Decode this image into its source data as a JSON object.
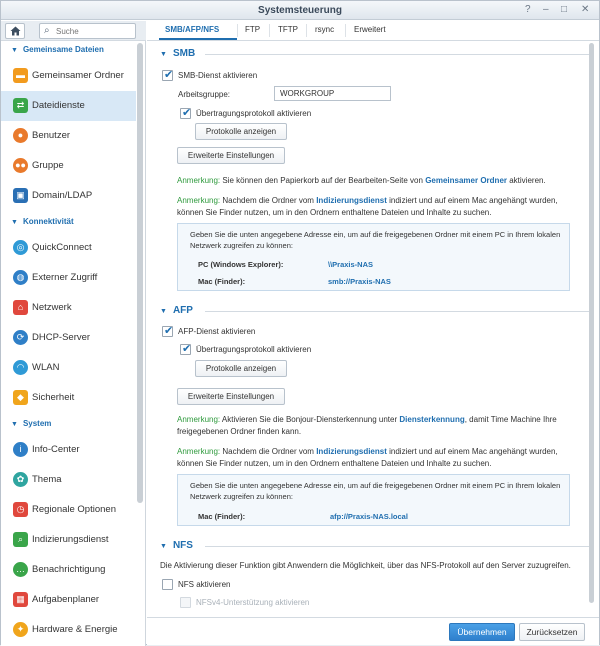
{
  "window": {
    "title": "Systemsteuerung",
    "controls": [
      "?",
      "–",
      "□",
      "✕"
    ]
  },
  "sidebar": {
    "search_placeholder": "Suche",
    "sections": [
      {
        "label": "Gemeinsame Dateien"
      },
      {
        "label": "Konnektivität"
      },
      {
        "label": "System"
      }
    ],
    "items": [
      {
        "label": "Gemeinsamer Ordner",
        "icon": "folder-icon",
        "color": "#f29b1e"
      },
      {
        "label": "Dateidienste",
        "icon": "file-services-icon",
        "color": "#3aa54a"
      },
      {
        "label": "Benutzer",
        "icon": "user-icon",
        "color": "#e97a2c"
      },
      {
        "label": "Gruppe",
        "icon": "group-icon",
        "color": "#e97a2c"
      },
      {
        "label": "Domain/LDAP",
        "icon": "domain-icon",
        "color": "#2a6fb4"
      },
      {
        "label": "QuickConnect",
        "icon": "quickconnect-icon",
        "color": "#2f9ad6"
      },
      {
        "label": "Externer Zugriff",
        "icon": "globe-icon",
        "color": "#2f7fc7"
      },
      {
        "label": "Netzwerk",
        "icon": "network-icon",
        "color": "#e0483d"
      },
      {
        "label": "DHCP-Server",
        "icon": "dhcp-icon",
        "color": "#2f7fc7"
      },
      {
        "label": "WLAN",
        "icon": "wifi-icon",
        "color": "#2f9ad6"
      },
      {
        "label": "Sicherheit",
        "icon": "shield-icon",
        "color": "#f0a51c"
      },
      {
        "label": "Info-Center",
        "icon": "info-icon",
        "color": "#2f7fc7"
      },
      {
        "label": "Thema",
        "icon": "palette-icon",
        "color": "#2fa5a0"
      },
      {
        "label": "Regionale Optionen",
        "icon": "regional-icon",
        "color": "#e0483d"
      },
      {
        "label": "Indizierungsdienst",
        "icon": "index-icon",
        "color": "#3aa54a"
      },
      {
        "label": "Benachrichtigung",
        "icon": "chat-icon",
        "color": "#3aa54a"
      },
      {
        "label": "Aufgabenplaner",
        "icon": "calendar-icon",
        "color": "#e0483d"
      },
      {
        "label": "Hardware & Energie",
        "icon": "bulb-icon",
        "color": "#f0a51c"
      }
    ]
  },
  "tabs": [
    {
      "label": "SMB/AFP/NFS"
    },
    {
      "label": "FTP"
    },
    {
      "label": "TFTP"
    },
    {
      "label": "rsync"
    },
    {
      "label": "Erweitert"
    }
  ],
  "smb": {
    "title": "SMB",
    "enable_label": "SMB-Dienst aktivieren",
    "workgroup_label": "Arbeitsgruppe:",
    "workgroup_value": "WORKGROUP",
    "transfer_log_label": "Übertragungsprotokoll aktivieren",
    "show_logs_button": "Protokolle anzeigen",
    "advanced_button": "Erweiterte Einstellungen",
    "note1_prefix": "Anmerkung:",
    "note1_text": "Sie können den Papierkorb auf der Bearbeiten-Seite von",
    "note1_link": "Gemeinsamer Ordner",
    "note1_suffix": "aktivieren.",
    "note2_prefix": "Anmerkung:",
    "note2_text_a": "Nachdem die Ordner vom",
    "note2_link": "Indizierungsdienst",
    "note2_text_b": "indiziert und auf einem Mac angehängt wurden,",
    "note2_text_c": "können Sie Finder nutzen, um in den Ordnern enthaltene Dateien und Inhalte zu suchen.",
    "info_text_a": "Geben Sie die unten angegebene Adresse ein, um auf die freigegebenen Ordner mit einem PC in Ihrem lokalen",
    "info_text_b": "Netzwerk zugreifen zu können:",
    "pc_label": "PC (Windows Explorer):",
    "pc_value": "\\\\Praxis-NAS",
    "mac_label": "Mac (Finder):",
    "mac_value": "smb://Praxis-NAS"
  },
  "afp": {
    "title": "AFP",
    "enable_label": "AFP-Dienst aktivieren",
    "transfer_log_label": "Übertragungsprotokoll aktivieren",
    "show_logs_button": "Protokolle anzeigen",
    "advanced_button": "Erweiterte Einstellungen",
    "note1_prefix": "Anmerkung:",
    "note1_text_a": "Aktivieren Sie die Bonjour-Diensterkennung unter",
    "note1_link": "Diensterkennung",
    "note1_text_b": ", damit Time Machine Ihre",
    "note1_text_c": "freigegebenen Ordner finden kann.",
    "note2_prefix": "Anmerkung:",
    "note2_text_a": "Nachdem die Ordner vom",
    "note2_link": "Indizierungsdienst",
    "note2_text_b": "indiziert und auf einem Mac angehängt wurden,",
    "note2_text_c": "können Sie Finder nutzen, um in den Ordnern enthaltene Dateien und Inhalte zu suchen.",
    "info_text_a": "Geben Sie die unten angegebene Adresse ein, um auf die freigegebenen Ordner mit einem PC in Ihrem lokalen",
    "info_text_b": "Netzwerk zugreifen zu können:",
    "mac_label": "Mac (Finder):",
    "mac_value": "afp://Praxis-NAS.local"
  },
  "nfs": {
    "title": "NFS",
    "description": "Die Aktivierung dieser Funktion gibt Anwendern die Möglichkeit, über das NFS-Protokoll auf den Server zuzugreifen.",
    "enable_label": "NFS aktivieren",
    "nfsv4_label": "NFSv4-Unterstützung aktivieren"
  },
  "footer": {
    "apply_button": "Übernehmen",
    "reset_button": "Zurücksetzen"
  }
}
